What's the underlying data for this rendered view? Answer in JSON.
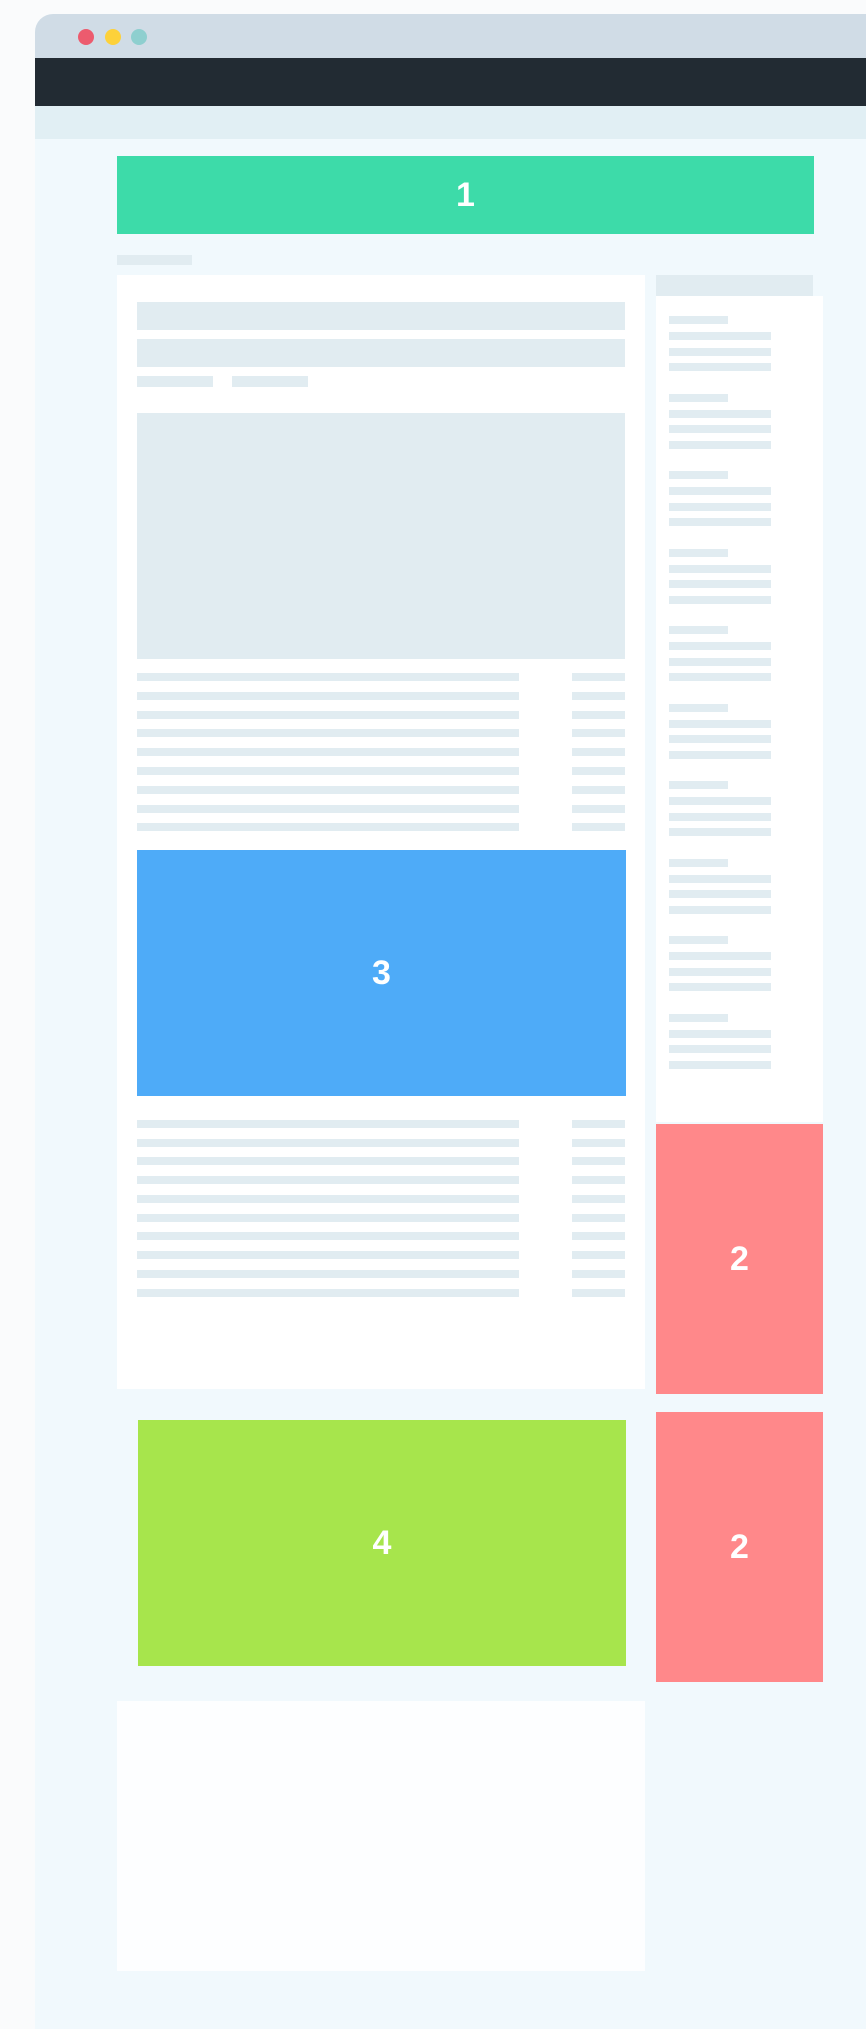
{
  "colors": {
    "titlebar": "#d0dce6",
    "navbar": "#222b33",
    "dot_close": "#ec5b6e",
    "dot_minimize": "#fdd13a",
    "dot_maximize": "#8ecfcf",
    "ad_1": "#3ddba9",
    "ad_2": "#ff888a",
    "ad_3": "#4eabf8",
    "ad_4": "#a7e54c",
    "placeholder": "#e1ecf1"
  },
  "ad_slots": {
    "top_banner_label": "1",
    "sidebar_top_label": "2",
    "sidebar_bottom_label": "2",
    "in_article_label": "3",
    "below_article_label": "4"
  }
}
